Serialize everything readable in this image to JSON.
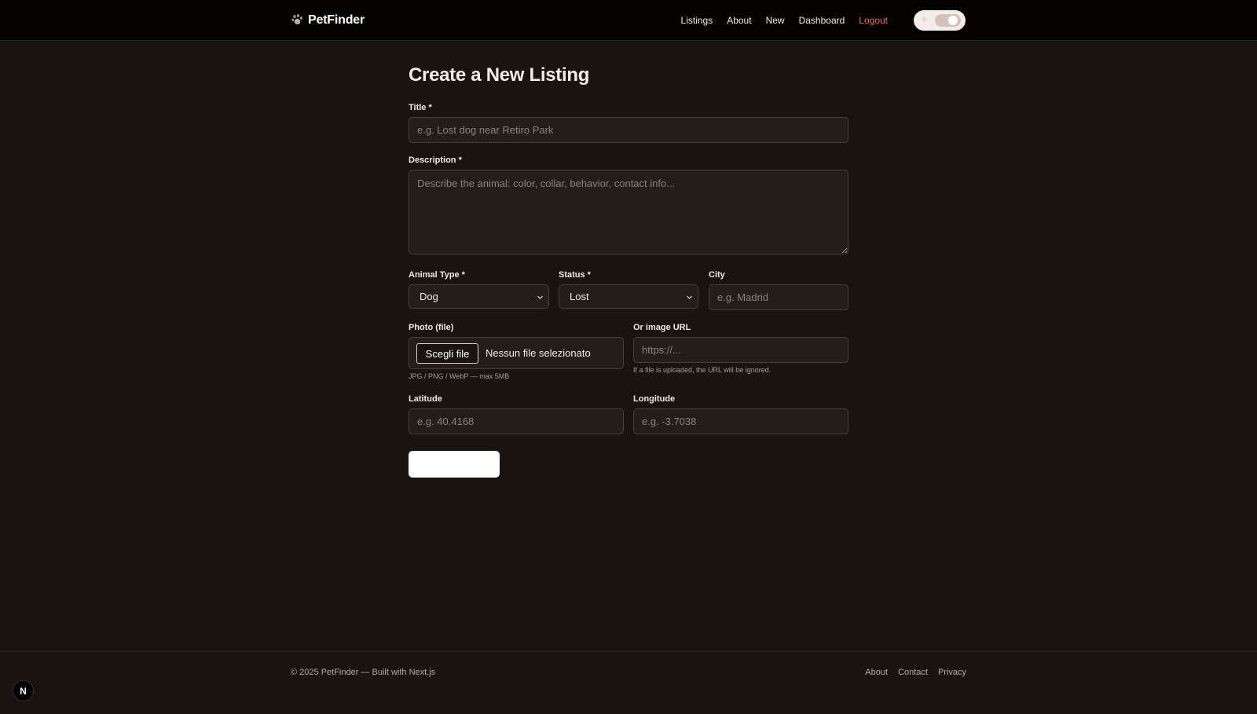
{
  "nav": {
    "brand": "PetFinder",
    "links": [
      "Listings",
      "About",
      "New",
      "Dashboard"
    ],
    "logout": "Logout"
  },
  "form": {
    "title": "Create a New Listing",
    "title_label": "Title *",
    "title_placeholder": "e.g. Lost dog near Retiro Park",
    "description_label": "Description *",
    "description_placeholder": "Describe the animal: color, collar, behavior, contact info...",
    "animal_type_label": "Animal Type *",
    "animal_type_value": "Dog",
    "status_label": "Status *",
    "status_value": "Lost",
    "city_label": "City",
    "city_placeholder": "e.g. Madrid",
    "photo_label": "Photo (file)",
    "file_button": "Scegli file",
    "file_status": "Nessun file selezionato",
    "photo_hint": "JPG / PNG / WebP — max 5MB",
    "image_url_label": "Or image URL",
    "image_url_placeholder": "https://...",
    "image_url_hint": "If a file is uploaded, the URL will be ignored.",
    "latitude_label": "Latitude",
    "latitude_placeholder": "e.g. 40.4168",
    "longitude_label": "Longitude",
    "longitude_placeholder": "e.g. -3.7038",
    "submit_label": ""
  },
  "footer": {
    "copyright": "© 2025 PetFinder — Built with Next.js",
    "links": [
      "About",
      "Contact",
      "Privacy"
    ]
  },
  "badge": {
    "label": "N"
  },
  "icons": {
    "brand": "paw-icon",
    "toggle": "sun-icon",
    "select": "chevron-down-icon"
  },
  "colors": {
    "background": "#1a1410",
    "navbar": "#050302",
    "logout": "#f06a6a",
    "field": "#241d19"
  }
}
